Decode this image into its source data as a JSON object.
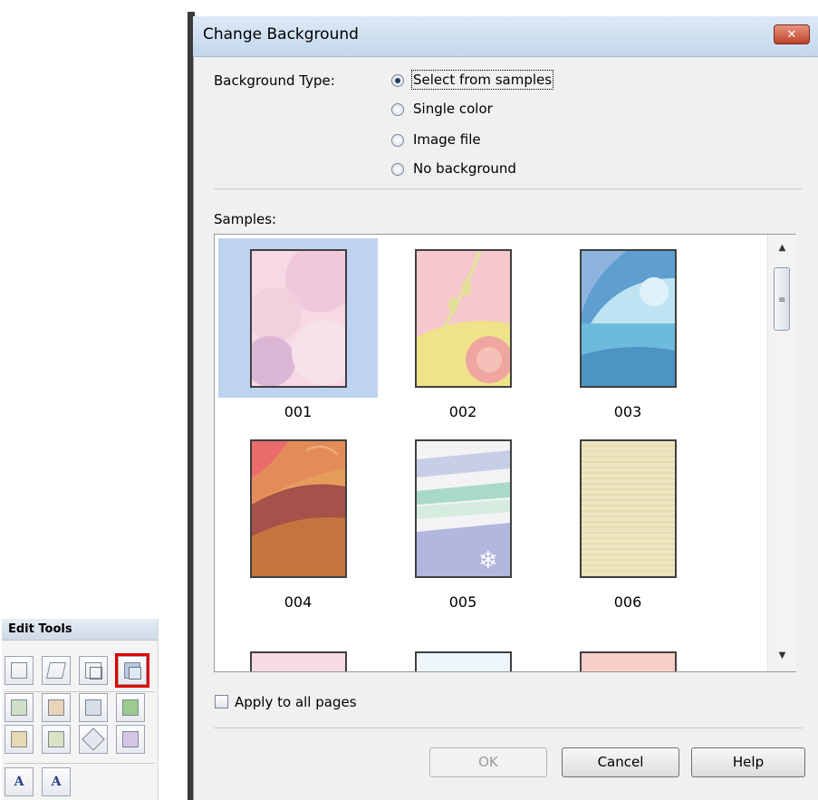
{
  "tools_panel": {
    "title": "Edit Tools",
    "row1_icons": [
      "layout-icon",
      "edit-page-icon",
      "add-page-icon",
      "change-background-icon"
    ],
    "row2_icons": [
      "add-image-icon",
      "swap-image-icon",
      "image-frame-icon",
      "insert-image-icon"
    ],
    "row3_icons": [
      "front-back-icon",
      "arrange-icon",
      "crop-icon",
      "correct-image-icon"
    ],
    "row4": [
      {
        "icon": "add-text-icon",
        "glyph": "A"
      },
      {
        "icon": "edit-text-icon",
        "glyph": "A"
      }
    ],
    "highlighted": "change-background-icon",
    "highlight_color": "#e00000"
  },
  "dialog": {
    "title": "Change Background",
    "close_glyph": "✕",
    "background_type_label": "Background Type:",
    "options": [
      {
        "label": "Select from samples",
        "selected": true
      },
      {
        "label": "Single color",
        "selected": false
      },
      {
        "label": "Image file",
        "selected": false
      },
      {
        "label": "No background",
        "selected": false
      }
    ],
    "samples_label": "Samples:",
    "samples": [
      {
        "caption": "001",
        "selected": true
      },
      {
        "caption": "002",
        "selected": false
      },
      {
        "caption": "003",
        "selected": false
      },
      {
        "caption": "004",
        "selected": false
      },
      {
        "caption": "005",
        "selected": false
      },
      {
        "caption": "006",
        "selected": false
      }
    ],
    "scroll_up_glyph": "▲",
    "scroll_down_glyph": "▼",
    "scroll_grip": "≡",
    "apply_all_label": "Apply to all pages",
    "apply_all_checked": false,
    "ok_label": "OK",
    "ok_enabled": false,
    "cancel_label": "Cancel",
    "help_label": "Help",
    "selection_color": "#bed3ef"
  }
}
